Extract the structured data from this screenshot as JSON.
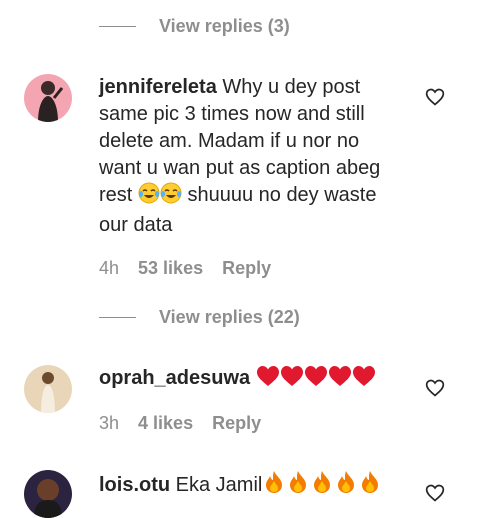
{
  "thread1": {
    "view_replies": "View replies (3)"
  },
  "comment1": {
    "username": "jennifereleta",
    "text_a": " Why u dey post same pic 3 times now and still delete am. Madam if u nor no want u wan put as caption abeg rest ",
    "text_b": " shuuuu no dey waste our data",
    "time": "4h",
    "likes": "53 likes",
    "reply": "Reply"
  },
  "thread2": {
    "view_replies": "View replies (22)"
  },
  "comment2": {
    "username": "oprah_adesuwa",
    "time": "3h",
    "likes": "4 likes",
    "reply": "Reply"
  },
  "comment3": {
    "username": "lois.otu",
    "text": " Eka Jamil"
  },
  "icons": {
    "like": "heart-outline-icon",
    "laugh": "face-with-tears-of-joy-emoji",
    "heart": "red-heart-emoji",
    "fire": "fire-emoji"
  },
  "colors": {
    "text": "#262626",
    "muted": "#8e8e8e",
    "heart_red": "#e0192f"
  }
}
